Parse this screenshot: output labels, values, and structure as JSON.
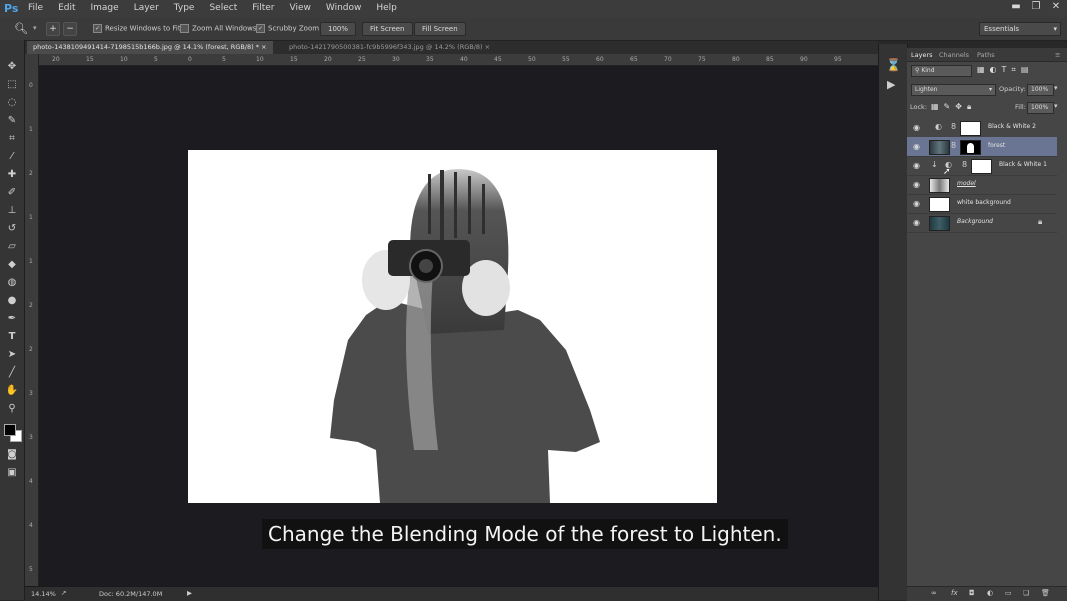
{
  "app": {
    "logo": "Ps"
  },
  "menu": [
    "File",
    "Edit",
    "Image",
    "Layer",
    "Type",
    "Select",
    "Filter",
    "View",
    "Window",
    "Help"
  ],
  "window_controls": {
    "minimize": "▬",
    "restore": "❐",
    "close": "✕"
  },
  "options": {
    "resize_windows": "Resize Windows to Fit",
    "zoom_all_windows": "Zoom All Windows",
    "scrubby_zoom": "Scrubby Zoom",
    "zoom_100": "100%",
    "fit_screen": "Fit Screen",
    "fill_screen": "Fill Screen",
    "workspace": "Essentials"
  },
  "tabs": [
    {
      "label": "photo-1438109491414-7198515b166b.jpg @ 14.1% (forest, RGB/8) *",
      "close": "×"
    },
    {
      "label": "photo-1421790500381-fc9b5996f343.jpg @ 14.2% (RGB/8)",
      "close": "×"
    }
  ],
  "ruler": {
    "h": [
      "20",
      "15",
      "10",
      "5",
      "0",
      "5",
      "10",
      "15",
      "20",
      "25",
      "30",
      "35",
      "40",
      "45",
      "50",
      "55",
      "60",
      "65",
      "70",
      "75",
      "80",
      "85",
      "90",
      "95"
    ],
    "v": [
      "0",
      "1",
      "2",
      "1",
      "1",
      "2",
      "2",
      "3",
      "3",
      "4",
      "4",
      "5"
    ]
  },
  "caption": "Change the Blending Mode of the forest to Lighten.",
  "status": {
    "zoom": "14.14%",
    "doc": "Doc: 60.2M/147.0M"
  },
  "layers_panel": {
    "tabs": [
      "Layers",
      "Channels",
      "Paths"
    ],
    "filter_kind": "Kind",
    "blend_mode": "Lighten",
    "opacity_label": "Opacity:",
    "opacity_value": "100%",
    "lock_label": "Lock:",
    "fill_label": "Fill:",
    "fill_value": "100%",
    "layers": [
      {
        "name": "Black & White 2",
        "type": "adjustment"
      },
      {
        "name": "forest",
        "type": "image-mask",
        "selected": true
      },
      {
        "name": "Black & White 1",
        "type": "adjustment-clipped"
      },
      {
        "name": "model",
        "type": "image"
      },
      {
        "name": "white background",
        "type": "fill"
      },
      {
        "name": "Background",
        "type": "image-locked"
      }
    ]
  },
  "colors": {
    "accent_blue": "#4ea5ea",
    "selected_layer": "#6a7493",
    "canvas_bg": "#1c1b1f"
  }
}
